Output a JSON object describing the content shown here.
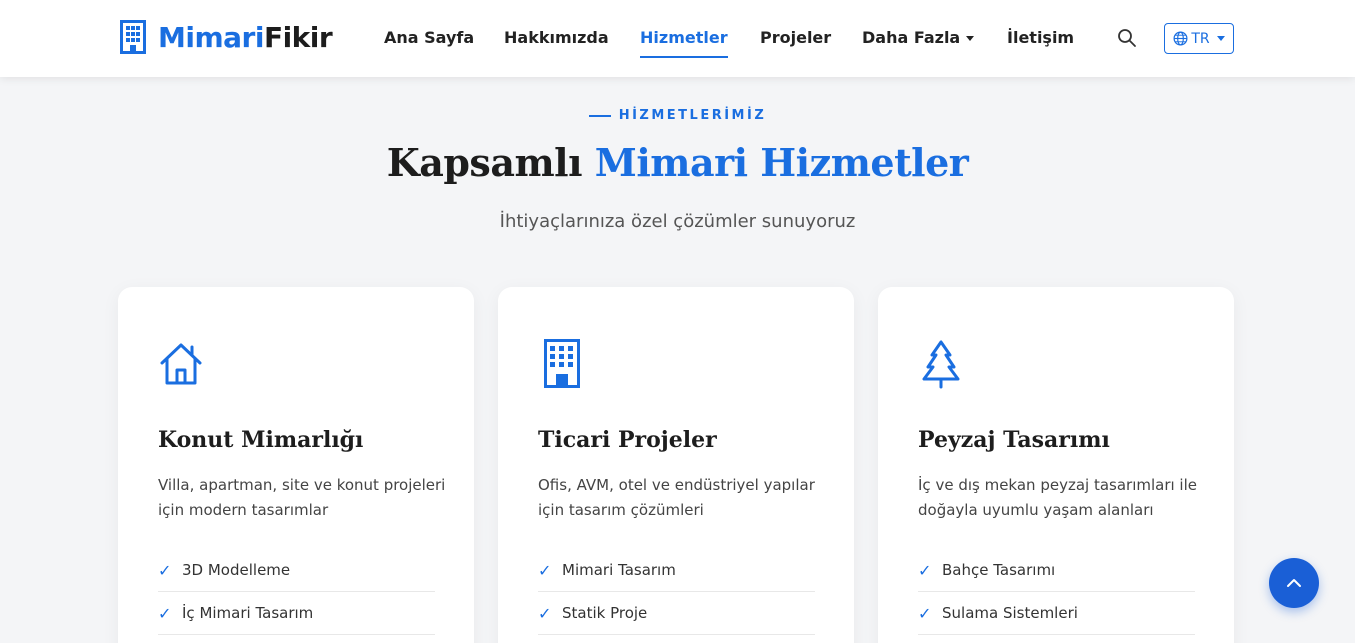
{
  "brand": {
    "name_primary": "Mimari",
    "name_secondary": "Fikir",
    "icon": "building-icon"
  },
  "nav": {
    "items": [
      {
        "label": "Ana Sayfa",
        "active": false
      },
      {
        "label": "Hakkımızda",
        "active": false
      },
      {
        "label": "Hizmetler",
        "active": true
      },
      {
        "label": "Projeler",
        "active": false
      },
      {
        "label": "Daha Fazla",
        "active": false,
        "dropdown": true
      },
      {
        "label": "İletişim",
        "active": false
      }
    ],
    "search_icon": "search-icon",
    "language": {
      "label": "TR",
      "icon": "globe-icon"
    }
  },
  "section": {
    "eyebrow": "HİZMETLERİMİZ",
    "headline_plain": "Kapsamlı",
    "headline_accent": "Mimari Hizmetler",
    "subtitle": "İhtiyaçlarınıza özel çözümler sunuyoruz"
  },
  "services": [
    {
      "icon": "house-icon",
      "title": "Konut Mimarlığı",
      "description": "Villa, apartman, site ve konut projeleri için modern tasarımlar",
      "features": [
        "3D Modelleme",
        "İç Mimari Tasarım"
      ]
    },
    {
      "icon": "office-building-icon",
      "title": "Ticari Projeler",
      "description": "Ofis, AVM, otel ve endüstriyel yapılar için tasarım çözümleri",
      "features": [
        "Mimari Tasarım",
        "Statik Proje"
      ]
    },
    {
      "icon": "tree-icon",
      "title": "Peyzaj Tasarımı",
      "description": "İç ve dış mekan peyzaj tasarımları ile doğayla uyumlu yaşam alanları",
      "features": [
        "Bahçe Tasarımı",
        "Sulama Sistemleri"
      ]
    }
  ],
  "check_symbol": "✓",
  "scroll_top_icon": "chevron-up-icon",
  "colors": {
    "accent": "#1a6ee0",
    "background": "#f4f5f7",
    "scroll_button": "#1a5fd6"
  }
}
